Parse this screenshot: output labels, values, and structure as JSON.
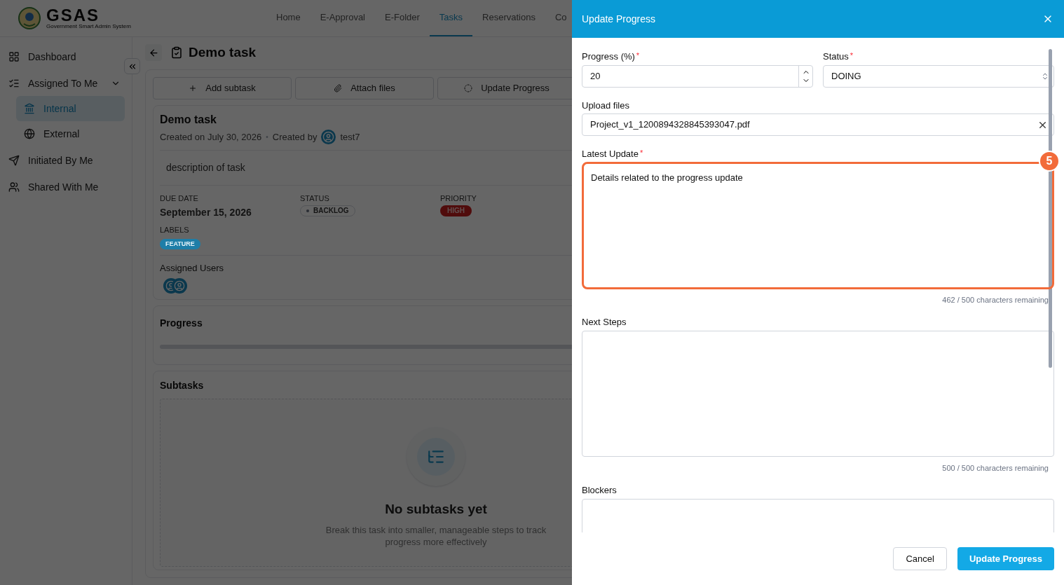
{
  "header": {
    "logo_title": "GSAS",
    "logo_subtitle": "Government Smart Admin System",
    "nav": [
      {
        "label": "Home",
        "selected": false
      },
      {
        "label": "E-Approval",
        "selected": false
      },
      {
        "label": "E-Folder",
        "selected": false
      },
      {
        "label": "Tasks",
        "selected": true
      },
      {
        "label": "Reservations",
        "selected": false
      },
      {
        "label": "Co",
        "selected": false
      }
    ]
  },
  "sidebar": {
    "items": [
      {
        "label": "Dashboard",
        "selected": false
      },
      {
        "label": "Assigned To Me",
        "selected": false,
        "expanded": true,
        "children": [
          {
            "label": "Internal",
            "selected": true
          },
          {
            "label": "External",
            "selected": false
          }
        ]
      },
      {
        "label": "Initiated By Me",
        "selected": false
      },
      {
        "label": "Shared With Me",
        "selected": false
      }
    ]
  },
  "page_title": "Demo task",
  "actions": [
    {
      "label": "Add subtask"
    },
    {
      "label": "Attach files"
    },
    {
      "label": "Update Progress"
    }
  ],
  "task": {
    "title": "Demo task",
    "created_on": "Created on July 30, 2026",
    "separator": "•",
    "created_by_label": "Created by",
    "creator": "test7",
    "description": "description of task",
    "fields": [
      {
        "label": "DUE DATE",
        "value": "September 15, 2026",
        "kind": "text"
      },
      {
        "label": "STATUS",
        "value": "BACKLOG",
        "kind": "status"
      },
      {
        "label": "PRIORITY",
        "value": "HIGH",
        "kind": "priority"
      }
    ],
    "labels_heading": "LABELS",
    "labels": [
      {
        "label": "FEATURE",
        "color": "#1e7ea8"
      }
    ],
    "assigned_heading": "Assigned Users",
    "assigned_users": [
      {
        "kind": "avatar"
      },
      {
        "kind": "avatar"
      }
    ]
  },
  "progress_card": {
    "title": "Progress",
    "level": 0
  },
  "subtasks": {
    "title": "Subtasks",
    "empty_title": "No subtasks yet",
    "empty_text": "Break this task into smaller, manageable steps to track progress more effectively"
  },
  "modal": {
    "title": "Update Progress",
    "progress": {
      "label": "Progress (%)",
      "required_mark": "*",
      "value": "20"
    },
    "status": {
      "label": "Status",
      "required_mark": "*",
      "value": "DOING"
    },
    "upload": {
      "label": "Upload files",
      "value": "Project_v1_1200894328845393047.pdf"
    },
    "latest_update": {
      "label": "Latest Update",
      "required_mark": "*",
      "value": "Details related to the progress update",
      "counter": "462 / 500 characters remaining",
      "highlighted": true,
      "badge": "5"
    },
    "next_steps": {
      "label": "Next Steps",
      "counter": "500 / 500 characters remaining"
    },
    "blockers": {
      "label": "Blockers"
    },
    "buttons": [
      {
        "label": "Cancel",
        "kind": "secondary"
      },
      {
        "label": "Update Progress",
        "kind": "primary"
      }
    ]
  }
}
